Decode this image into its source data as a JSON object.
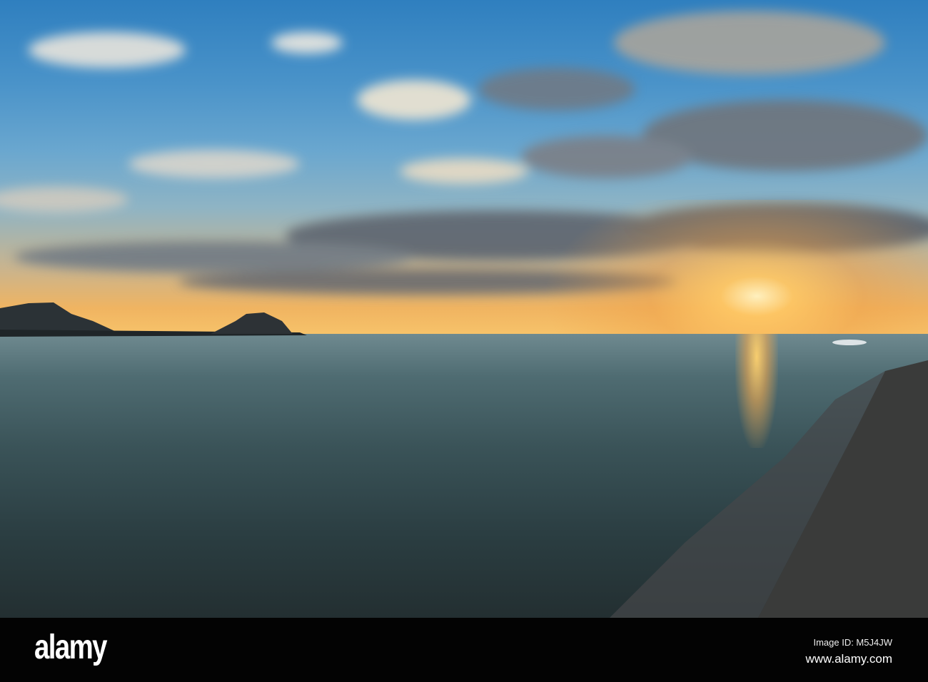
{
  "watermark": {
    "brand": "alamy",
    "image_id": "Image ID: M5J4JW",
    "website": "www.alamy.com"
  }
}
